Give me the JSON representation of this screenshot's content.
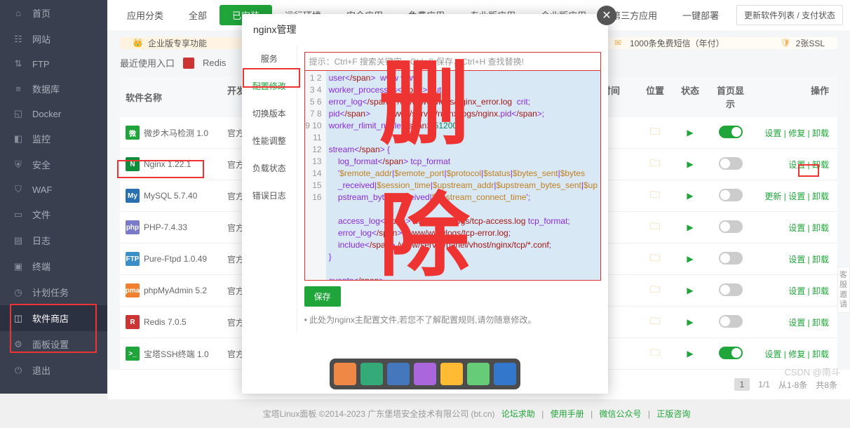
{
  "sidebar": {
    "items": [
      {
        "icon": "home",
        "label": "首页"
      },
      {
        "icon": "globe",
        "label": "网站"
      },
      {
        "icon": "ftp",
        "label": "FTP"
      },
      {
        "icon": "db",
        "label": "数据库"
      },
      {
        "icon": "docker",
        "label": "Docker"
      },
      {
        "icon": "monitor",
        "label": "监控"
      },
      {
        "icon": "shield",
        "label": "安全"
      },
      {
        "icon": "waf",
        "label": "WAF"
      },
      {
        "icon": "file",
        "label": "文件"
      },
      {
        "icon": "log",
        "label": "日志"
      },
      {
        "icon": "terminal",
        "label": "终端"
      },
      {
        "icon": "cron",
        "label": "计划任务"
      },
      {
        "icon": "store",
        "label": "软件商店"
      },
      {
        "icon": "settings",
        "label": "面板设置"
      },
      {
        "icon": "exit",
        "label": "退出"
      }
    ]
  },
  "tabs": [
    "应用分类",
    "全部",
    "已安装",
    "运行环境",
    "安全应用",
    "免费应用",
    "专业版应用",
    "企业版应用",
    "第三方应用",
    "一键部署"
  ],
  "update_btn": "更新软件列表 / 支付状态",
  "promo": {
    "p1": "企业版专享功能",
    "p2": "1000条免费短信（年付）",
    "p3": "2张SSL"
  },
  "recent": {
    "label": "最近使用入口",
    "item": "Redis"
  },
  "thead": {
    "name": "软件名称",
    "vendor": "开发商",
    "desc": "",
    "expire": "到期时间",
    "pos": "位置",
    "stat": "状态",
    "home": "首页显示",
    "ops": "操作"
  },
  "rows": [
    {
      "icon_bg": "#20a53a",
      "icon_txt": "微",
      "name": "微步木马检测 1.0",
      "vendor": "官方",
      "home": true,
      "ops": "设置 | 修复 | 卸载"
    },
    {
      "icon_bg": "#0d8f3a",
      "icon_txt": "N",
      "name": "Nginx 1.22.1",
      "vendor": "官方",
      "home": false,
      "ops": "设置 | 卸载"
    },
    {
      "icon_bg": "#2a6fb0",
      "icon_txt": "My",
      "name": "MySQL 5.7.40",
      "vendor": "官方",
      "home": false,
      "ops": "更新 | 设置 | 卸载"
    },
    {
      "icon_bg": "#7a7bc8",
      "icon_txt": "php",
      "name": "PHP-7.4.33",
      "vendor": "官方",
      "home": false,
      "ops": "设置 | 卸载"
    },
    {
      "icon_bg": "#3a8fc8",
      "icon_txt": "FTP",
      "name": "Pure-Ftpd 1.0.49",
      "vendor": "官方",
      "home": false,
      "ops": "设置 | 卸载"
    },
    {
      "icon_bg": "#f08030",
      "icon_txt": "pma",
      "name": "phpMyAdmin 5.2",
      "vendor": "官方",
      "home": false,
      "ops": "设置 | 卸载"
    },
    {
      "icon_bg": "#c33",
      "icon_txt": "R",
      "name": "Redis 7.0.5",
      "vendor": "官方",
      "home": false,
      "ops": "设置 | 卸载"
    },
    {
      "icon_bg": "#20a53a",
      "icon_txt": ">_",
      "name": "宝塔SSH终端 1.0",
      "vendor": "官方",
      "home": true,
      "ops": "设置 | 修复 | 卸载"
    }
  ],
  "pager": {
    "cur": "1",
    "pages": "1/1",
    "range": "从1-8条",
    "total": "共8条"
  },
  "footer": {
    "copy": "宝塔Linux面板 ©2014-2023 广东堡塔安全技术有限公司 (bt.cn)",
    "links": [
      "论坛求助",
      "使用手册",
      "微信公众号",
      "正版咨询"
    ]
  },
  "modal": {
    "title": "nginx管理",
    "tabs": [
      "服务",
      "配置修改",
      "切换版本",
      "性能调整",
      "负载状态",
      "错误日志"
    ],
    "hint": "提示：Ctrl+F 搜索关键字，Ctrl+S 保存，Ctrl+H 查找替换!",
    "save": "保存",
    "warn": "• 此处为nginx主配置文件,若您不了解配置规则,请勿随意修改。",
    "code_lines": [
      "user  www www;",
      "worker_processes auto;",
      "error_log  /www/wwwlogs/nginx_error.log  crit;",
      "pid        /www/server/nginx/logs/nginx.pid;",
      "worker_rlimit_nofile 51200;",
      "",
      "stream {",
      "    log_format tcp_format",
      "    '$remote_addr|$remote_port|$protocol|$status|$bytes_sent|$bytes",
      "    _received|$session_time|$upstream_addr|$upstream_bytes_sent|$up",
      "    pstream_bytes_received|$upstream_connect_time';",
      "",
      "    access_log /www/wwwlogs/tcp-access.log tcp_format;",
      "    error_log /www/wwwlogs/tcp-error.log;",
      "    include /www/server/panel/vhost/nginx/tcp/*.conf;",
      "}",
      "",
      "events",
      "    {"
    ]
  },
  "overlay_text": "删除",
  "watermark": "CSDN @南斗",
  "side_float": "客服邀请"
}
